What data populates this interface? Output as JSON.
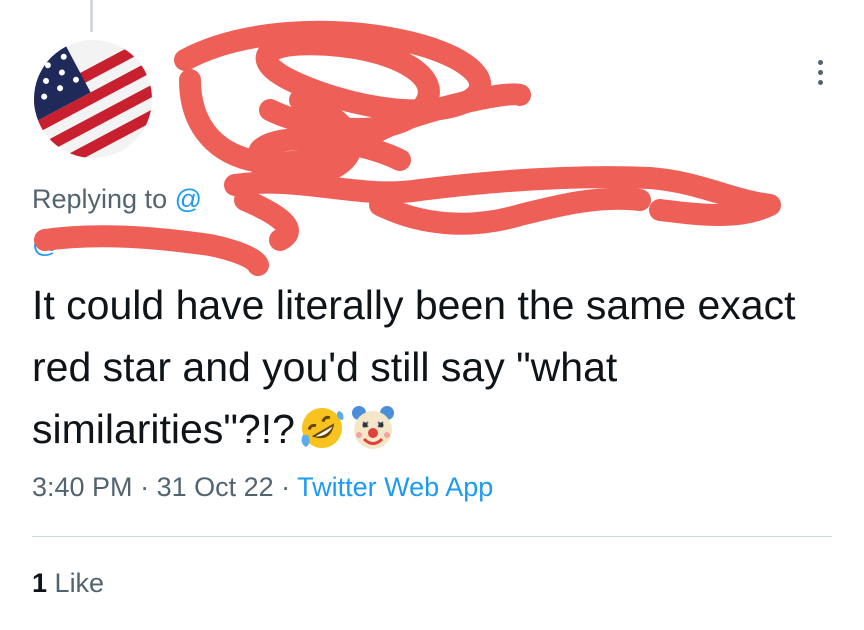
{
  "avatar": {
    "icon": "american-flag-avatar",
    "colors": {
      "red": "#c8202f",
      "white": "#ffffff",
      "blue": "#1f2a5a"
    }
  },
  "more_icon": "more-dots-icon",
  "reply": {
    "prefix": "Replying to",
    "mention1": "@",
    "mention2": "@"
  },
  "tweet": {
    "text": "It could have literally been the same exact red star and you'd still say \"what similarities\"?!?",
    "emojis": [
      "rolling-on-floor-laughing-emoji",
      "clown-face-emoji"
    ]
  },
  "meta": {
    "time": "3:40 PM",
    "sep1": " · ",
    "date": "31 Oct 22",
    "sep2": " · ",
    "source": "Twitter Web App"
  },
  "stats": {
    "like_count": "1",
    "like_label": "Like"
  },
  "colors": {
    "accent": "#1d9bf0",
    "secondary_text": "#536471",
    "scribble": "#ee5f57"
  }
}
